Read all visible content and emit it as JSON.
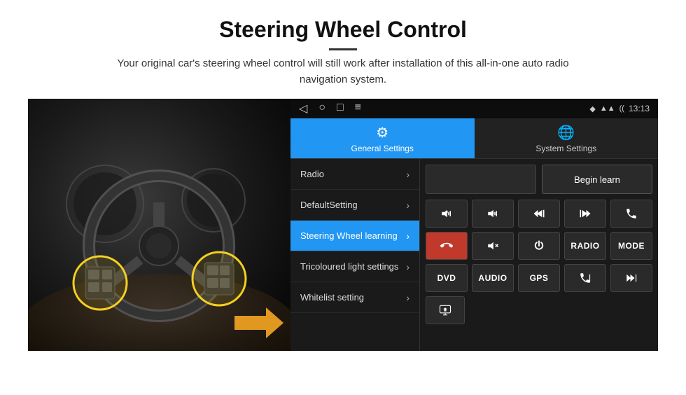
{
  "header": {
    "title": "Steering Wheel Control",
    "subtitle": "Your original car's steering wheel control will still work after installation of this all-in-one auto radio navigation system."
  },
  "status_bar": {
    "nav_back": "◁",
    "nav_home": "○",
    "nav_recent": "□",
    "nav_menu": "≡",
    "signal_icon": "▾",
    "wifi_icon": "▾",
    "time": "13:13"
  },
  "tabs": [
    {
      "id": "general",
      "label": "General Settings",
      "active": true
    },
    {
      "id": "system",
      "label": "System Settings",
      "active": false
    }
  ],
  "menu_items": [
    {
      "id": "radio",
      "label": "Radio",
      "active": false
    },
    {
      "id": "default",
      "label": "DefaultSetting",
      "active": false
    },
    {
      "id": "steering",
      "label": "Steering Wheel learning",
      "active": true
    },
    {
      "id": "tricoloured",
      "label": "Tricoloured light settings",
      "active": false
    },
    {
      "id": "whitelist",
      "label": "Whitelist setting",
      "active": false
    }
  ],
  "right_panel": {
    "begin_learn_label": "Begin learn",
    "control_rows": [
      [
        {
          "id": "vol_up",
          "type": "icon",
          "label": "VOL+"
        },
        {
          "id": "vol_down",
          "type": "icon",
          "label": "VOL-"
        },
        {
          "id": "prev_track",
          "type": "icon",
          "label": "|◀◀"
        },
        {
          "id": "next_track",
          "type": "icon",
          "label": "▶▶|"
        },
        {
          "id": "phone",
          "type": "icon",
          "label": "☎"
        }
      ],
      [
        {
          "id": "answer",
          "type": "icon",
          "label": "↙"
        },
        {
          "id": "mute",
          "type": "icon",
          "label": "🔇"
        },
        {
          "id": "power",
          "type": "icon",
          "label": "⏻"
        },
        {
          "id": "radio_btn",
          "type": "text",
          "label": "RADIO"
        },
        {
          "id": "mode_btn",
          "type": "text",
          "label": "MODE"
        }
      ],
      [
        {
          "id": "dvd_btn",
          "type": "text",
          "label": "DVD"
        },
        {
          "id": "audio_btn",
          "type": "text",
          "label": "AUDIO"
        },
        {
          "id": "gps_btn",
          "type": "text",
          "label": "GPS"
        },
        {
          "id": "phone2",
          "type": "icon",
          "label": "☎|◀"
        },
        {
          "id": "prev2",
          "type": "icon",
          "label": "⊳|◀◀"
        }
      ],
      [
        {
          "id": "media_icon",
          "type": "icon",
          "label": "🎵"
        }
      ]
    ]
  }
}
